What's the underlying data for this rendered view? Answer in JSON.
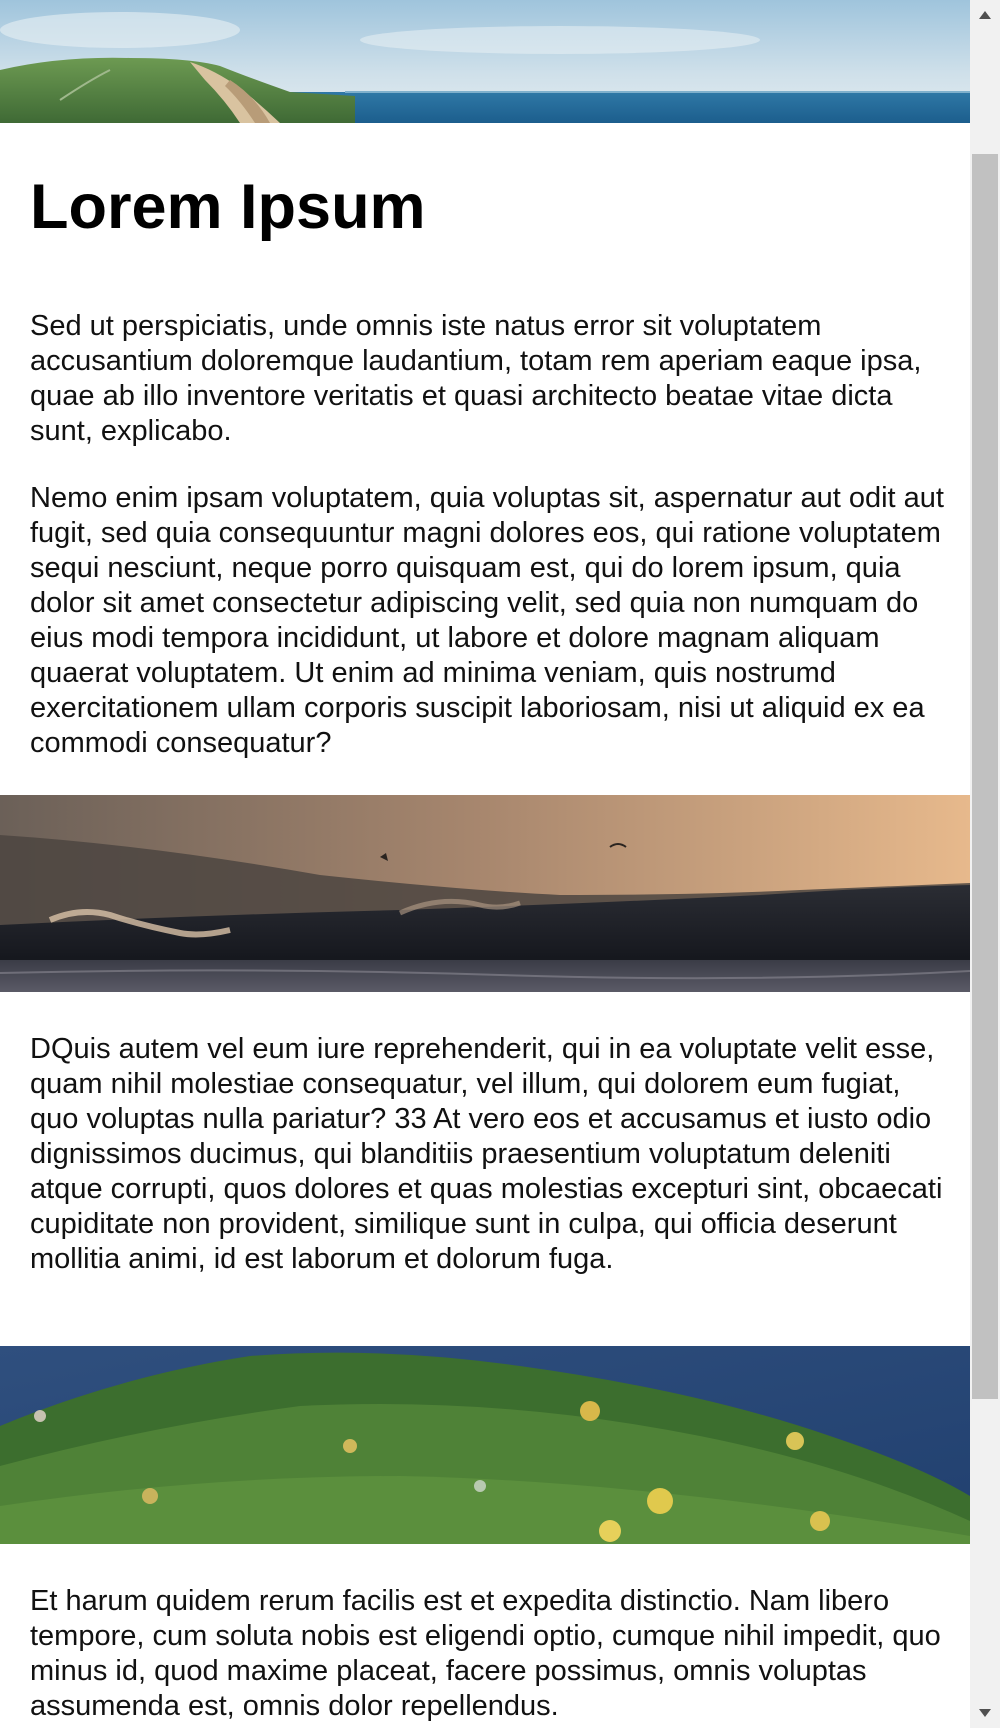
{
  "article": {
    "title": "Lorem Ipsum",
    "paragraphs": [
      "Sed ut perspiciatis, unde omnis iste natus error sit voluptatem accusantium doloremque laudantium, totam rem aperiam eaque ipsa, quae ab illo inventore veritatis et quasi architecto beatae vitae dicta sunt, explicabo.",
      "Nemo enim ipsam voluptatem, quia voluptas sit, aspernatur aut odit aut fugit, sed quia consequuntur magni dolores eos, qui ratione voluptatem sequi nesciunt, neque porro quisquam est, qui do lorem ipsum, quia dolor sit amet consectetur adipiscing velit, sed quia non numquam do eius modi tempora incididunt, ut labore et dolore magnam aliquam quaerat voluptatem. Ut enim ad minima veniam, quis nostrumd exercitationem ullam corporis suscipit laboriosam, nisi ut aliquid ex ea commodi consequatur?",
      "DQuis autem vel eum iure reprehenderit, qui in ea voluptate velit esse, quam nihil molestiae consequatur, vel illum, qui dolorem eum fugiat, quo voluptas nulla pariatur? 33 At vero eos et accusamus et iusto odio dignissimos ducimus, qui blanditiis praesentium voluptatum deleniti atque corrupti, quos dolores et quas molestias excepturi sint, obcaecati cupiditate non provident, similique sunt in culpa, qui officia deserunt mollitia animi, id est laborum et dolorum fuga.",
      "Et harum quidem rerum facilis est et expedita distinctio. Nam libero tempore, cum soluta nobis est eligendi optio, cumque nihil impedit, quo minus id, quod maxime placeat, facere possimus, omnis voluptas assumenda est, omnis dolor repellendus."
    ]
  },
  "images": {
    "top": "coastal-cliff-sea-photo",
    "middle": "ocean-wave-sunset-photo",
    "bottom": "aerial-forest-coast-photo"
  },
  "scrollbar": {
    "up_icon": "triangle-up-icon",
    "down_icon": "triangle-down-icon",
    "colors": {
      "track": "#f1f1f1",
      "thumb": "#c1c1c1",
      "arrow": "#505050"
    }
  }
}
